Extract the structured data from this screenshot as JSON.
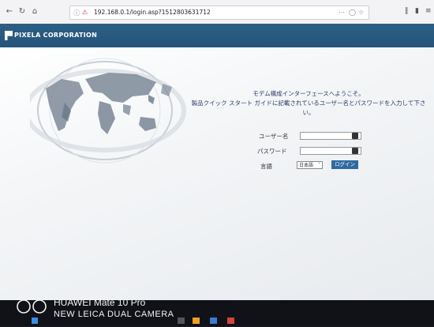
{
  "browser": {
    "url": "192.168.0.1/login.asp?1512803631712",
    "icons": [
      "back-icon",
      "reload-icon",
      "home-icon",
      "info-icon",
      "lock-warning-icon",
      "more-icon",
      "pocket-icon",
      "bookmark-star-icon",
      "library-icon",
      "sidebar-icon",
      "menu-icon"
    ]
  },
  "header": {
    "brand": "PIXELA CORPORATION"
  },
  "welcome": {
    "line1": "モデム構成インターフェースへようこそ。",
    "line2": "製品クイック スタート ガイドに記載されているユーザー名とパスワードを入力して下さい。"
  },
  "form": {
    "username_label": "ユーザー名",
    "username_value": "",
    "password_label": "パスワード",
    "password_value": "",
    "language_label": "言語",
    "language_value": "日本語",
    "login_label": "ログイン"
  },
  "watermark": {
    "line1": "HUAWEI Mate 10 Pro",
    "line2": "NEW LEICA DUAL CAMERA"
  },
  "colors": {
    "header": "#25547a",
    "button": "#2e6aa0",
    "welcome_text": "#2a3b66"
  }
}
